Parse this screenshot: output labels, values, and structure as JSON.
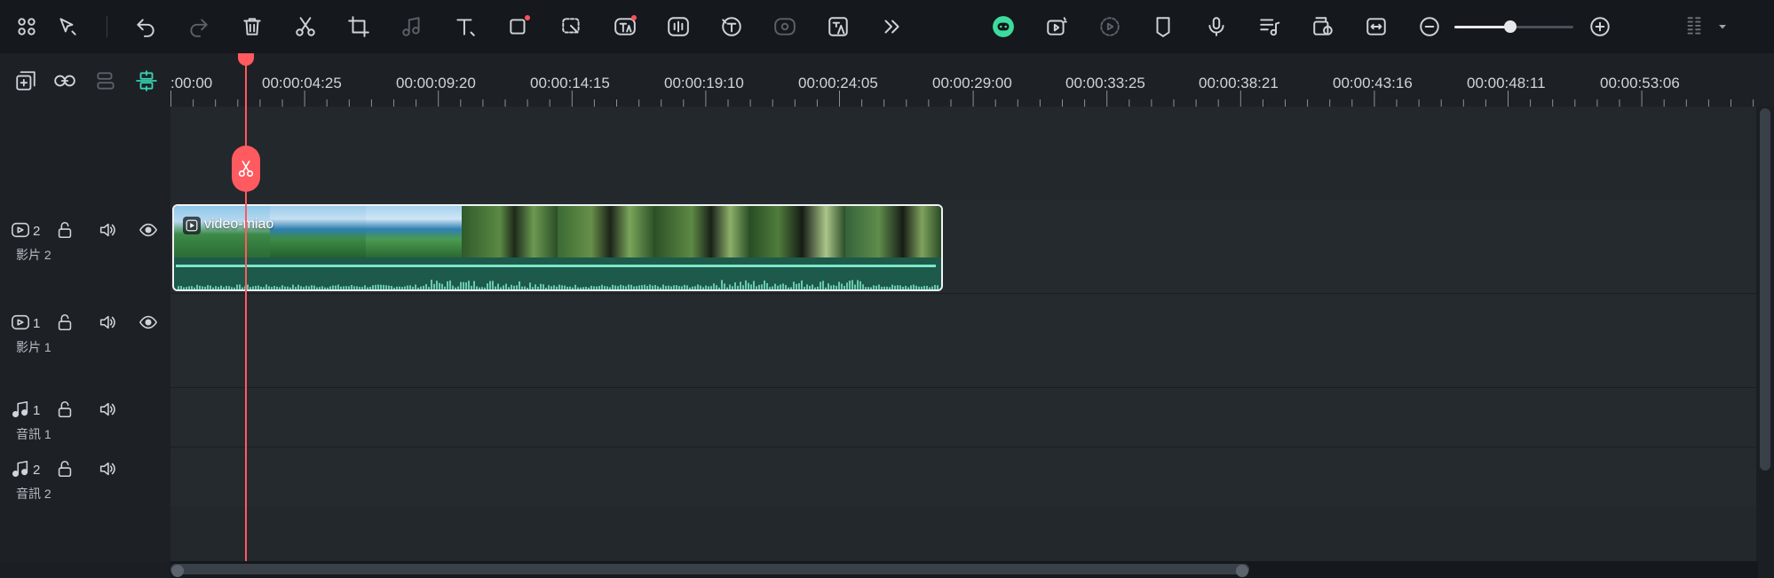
{
  "toolbar": {
    "left_icons": [
      "grid-icon",
      "select-arrow-icon",
      "undo-icon",
      "redo-icon",
      "delete-icon",
      "cut-icon",
      "crop-icon",
      "audio-effect-icon",
      "text-icon",
      "shape-icon",
      "mask-icon",
      "ai-text-icon",
      "audio-waveform-icon",
      "text-to-speech-icon",
      "speed-icon",
      "translate-icon",
      "more-icon"
    ],
    "right_icons": [
      "ai-assistant-icon",
      "ai-video-icon",
      "render-preview-icon",
      "marker-icon",
      "microphone-icon",
      "music-list-icon",
      "snapshot-icon",
      "fit-width-icon",
      "zoom-out-icon",
      "zoom-in-icon",
      "layout-icon"
    ],
    "zoom_level": 0.46
  },
  "timeline_tools": [
    "add-track-icon",
    "link-icon",
    "group-icon",
    "magnet-snap-icon"
  ],
  "ruler": {
    "labels": [
      ":00:00",
      "00:00:04:25",
      "00:00:09:20",
      "00:00:14:15",
      "00:00:19:10",
      "00:00:24:05",
      "00:00:29:00",
      "00:00:33:25",
      "00:00:38:21",
      "00:00:43:16",
      "00:00:48:11",
      "00:00:53:06"
    ]
  },
  "tracks": [
    {
      "kind": "video",
      "num": "2",
      "name": "影片 2",
      "has_eye": true
    },
    {
      "kind": "video",
      "num": "1",
      "name": "影片 1",
      "has_eye": true
    },
    {
      "kind": "audio",
      "num": "1",
      "name": "音訊 1",
      "has_eye": false
    },
    {
      "kind": "audio",
      "num": "2",
      "name": "音訊 2",
      "has_eye": false
    }
  ],
  "clip": {
    "title": "video-miao",
    "track": "影片 2"
  },
  "colors": {
    "accent": "#36d2b0",
    "playhead": "#ff5a5f",
    "clip_audio": "#1d5a4b",
    "waveform": "#7fe6c6"
  }
}
